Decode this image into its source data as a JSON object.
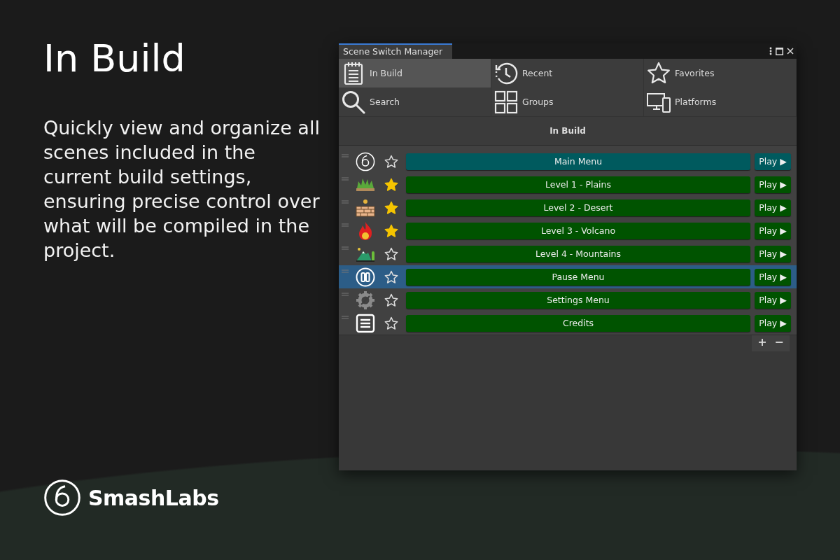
{
  "hero": {
    "title": "In Build",
    "description": "Quickly view and organize all scenes included in the current build settings, ensuring precise control over what will be compiled in the project.",
    "brand": "SmashLabs"
  },
  "window": {
    "title": "Scene Switch Manager"
  },
  "nav": [
    {
      "label": "In Build",
      "kind": "notepad",
      "selected": true
    },
    {
      "label": "Recent",
      "kind": "history",
      "selected": false
    },
    {
      "label": "Favorites",
      "kind": "star",
      "selected": false
    },
    {
      "label": "Search",
      "kind": "search",
      "selected": false
    },
    {
      "label": "Groups",
      "kind": "grid",
      "selected": false
    },
    {
      "label": "Platforms",
      "kind": "devices",
      "selected": false
    }
  ],
  "section_title": "In Build",
  "scenes": [
    {
      "name": "Main Menu",
      "kind": "logo",
      "favorite": false,
      "selected": false,
      "color": "#005a5e",
      "play": "Play ▶"
    },
    {
      "name": "Level 1 - Plains",
      "kind": "grass",
      "favorite": true,
      "selected": false,
      "color": "#005300",
      "play": "Play ▶"
    },
    {
      "name": "Level 2 - Desert",
      "kind": "desert",
      "favorite": true,
      "selected": false,
      "color": "#005300",
      "play": "Play ▶"
    },
    {
      "name": "Level 3 - Volcano",
      "kind": "fire",
      "favorite": true,
      "selected": false,
      "color": "#005300",
      "play": "Play ▶"
    },
    {
      "name": "Level 4 - Mountains",
      "kind": "mountains",
      "favorite": false,
      "selected": false,
      "color": "#005300",
      "play": "Play ▶"
    },
    {
      "name": "Pause Menu",
      "kind": "pause",
      "favorite": false,
      "selected": true,
      "color": "#005300",
      "play": "Play ▶"
    },
    {
      "name": "Settings Menu",
      "kind": "gear",
      "favorite": false,
      "selected": false,
      "color": "#005300",
      "play": "Play ▶"
    },
    {
      "name": "Credits",
      "kind": "list",
      "favorite": false,
      "selected": false,
      "color": "#005300",
      "play": "Play ▶"
    }
  ],
  "footer_buttons": [
    "+",
    "−"
  ]
}
